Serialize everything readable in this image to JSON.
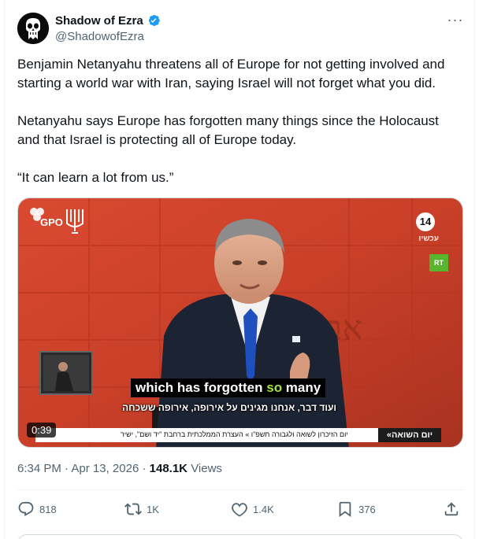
{
  "author": {
    "display_name": "Shadow of Ezra",
    "handle": "@ShadowofEzra",
    "verified": true
  },
  "tweet": {
    "paragraphs": [
      "Benjamin Netanyahu threatens all of Europe for not getting involved and starting a world war with Iran, saying Israel will not forget what you did.",
      "Netanyahu says Europe has forgotten many things since the Holocaust and that Israel is protecting all of Europe today.",
      "“It can learn a lot from us.”"
    ]
  },
  "video": {
    "duration": "0:39",
    "gpo_label": "GPO",
    "channel_number": "14",
    "channel_sub": "עכשיו",
    "rt_label": "RT",
    "subtitle_en_before": "which has forgotten ",
    "subtitle_en_highlight": "so",
    "subtitle_en_after": " many",
    "subtitle_he": "ועוד דבר, אנחנו מגינים על אירופה, אירופה ששכחה",
    "ticker_text": "יום הזיכרון לשואה ולגבורה תשפ\"ו » העצרת הממלכתית ברחבת \"יד ושם\", ישיר",
    "ticker_tag": "יום השואה»"
  },
  "meta": {
    "time": "6:34 PM",
    "separator": "·",
    "date": "Apr 13, 2026",
    "views_count": "148.1K",
    "views_label": "Views"
  },
  "actions": {
    "replies": "818",
    "reposts": "1K",
    "likes": "1.4K",
    "bookmarks": "376"
  },
  "colors": {
    "text_primary": "#0f1419",
    "text_secondary": "#536471",
    "verified_blue": "#1d9bf0",
    "divider": "#eff3f4",
    "subtitle_highlight": "#a6e23e",
    "rt_green": "#5ab52e"
  },
  "icons": [
    "verified-badge-icon",
    "more-icon",
    "reply-icon",
    "repost-icon",
    "like-icon",
    "bookmark-icon",
    "share-icon",
    "gpo-logo-icon",
    "menorah-icon"
  ]
}
